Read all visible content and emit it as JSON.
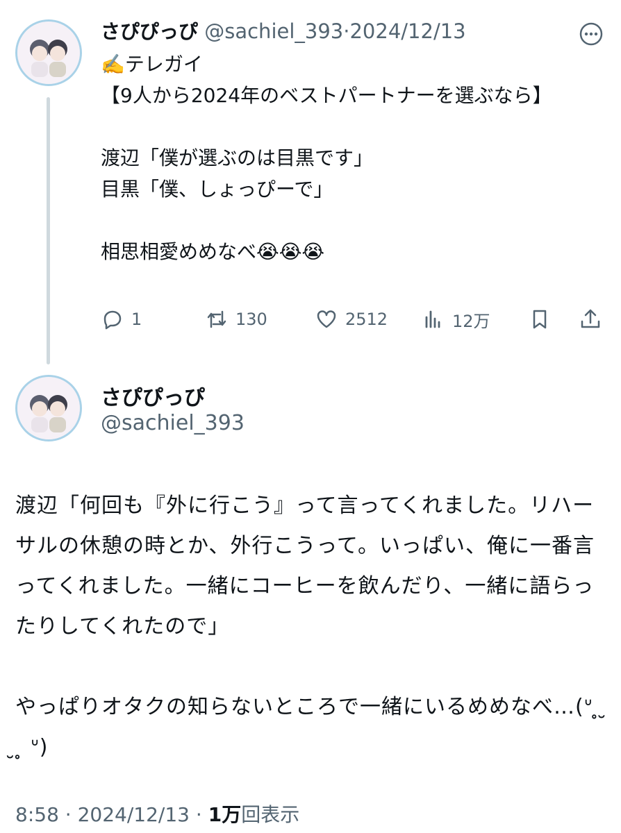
{
  "tweet1": {
    "display_name": "さぴぴっぴ",
    "handle": "@sachiel_393",
    "separator": "·",
    "date": "2024/12/13",
    "text": "✍️テレガイ\n【9人から2024年のベストパートナーを選ぶなら】\n\n渡辺「僕が選ぶのは目黒です」\n目黒「僕、しょっぴーで」\n\n相思相愛めめなべ😭😭😭",
    "actions": {
      "replies": "1",
      "reposts": "130",
      "likes": "2512",
      "views": "12万"
    },
    "icons": {
      "more": "more-icon",
      "reply": "reply-icon",
      "repost": "repost-icon",
      "like": "heart-icon",
      "views": "views-icon",
      "bookmark": "bookmark-icon",
      "share": "share-icon"
    }
  },
  "tweet2": {
    "display_name": "さぴぴっぴ",
    "handle": "@sachiel_393",
    "text": "渡辺「何回も『外に行こう』って言ってくれました。リハーサルの休憩の時とか、外行こうって。いっぱい、俺に一番言ってくれました。一緒にコーヒーを飲んだり、一緒に語らったりしてくれたので」\n\nやっぱりオタクの知らないところで一緒にいるめめなべ…(ᐡ ̥ ̮ ̥ ᐡ)",
    "time": "8:58",
    "date": "2024/12/13",
    "separator": "·",
    "view_count": "1万",
    "view_label": "回表示"
  },
  "colors": {
    "text": "#0f1419",
    "muted": "#536471",
    "thread_line": "#cfd9de",
    "avatar_ring": "#a9d2e8"
  }
}
